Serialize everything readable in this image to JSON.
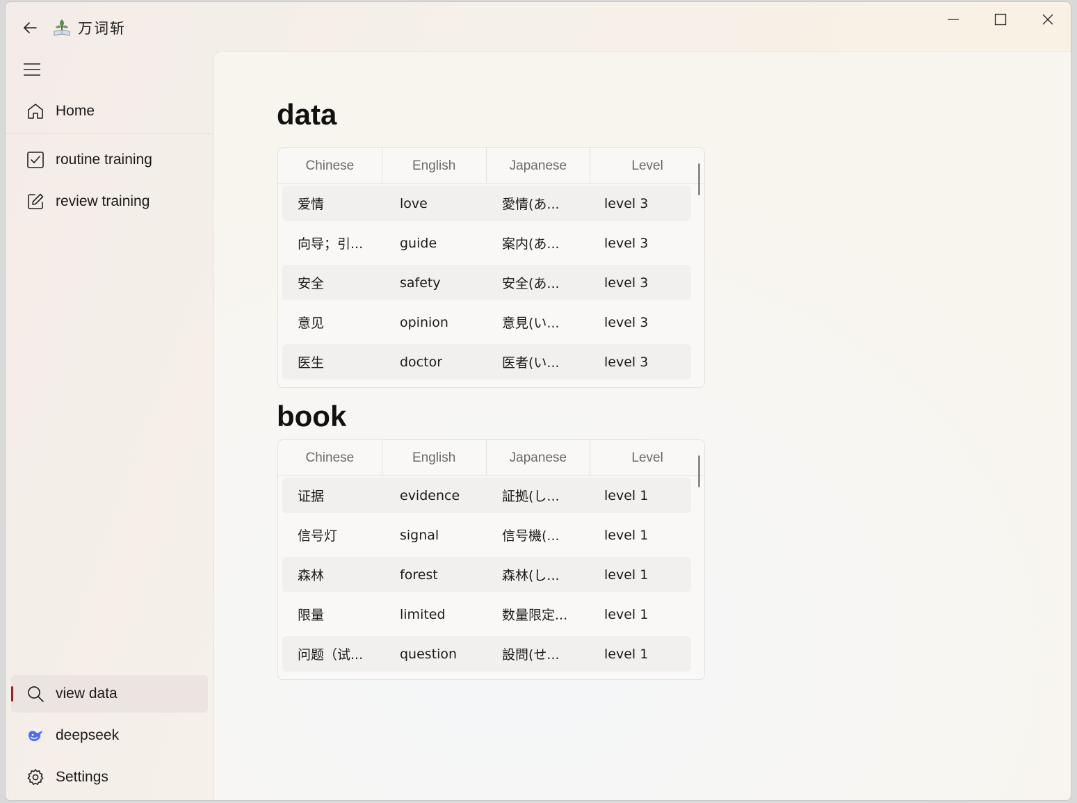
{
  "app": {
    "title": "万词斩"
  },
  "nav": {
    "home": "Home",
    "routine": "routine training",
    "review": "review training",
    "view_data": "view data",
    "deepseek": "deepseek",
    "settings": "Settings"
  },
  "tables": [
    {
      "title": "data",
      "headers": [
        "Chinese",
        "English",
        "Japanese",
        "Level"
      ],
      "rows": [
        [
          "爱情",
          "love",
          "愛情(あ...",
          "level 3"
        ],
        [
          "向导；引...",
          "guide",
          "案内(あ...",
          "level 3"
        ],
        [
          "安全",
          "safety",
          "安全(あ...",
          "level 3"
        ],
        [
          "意见",
          "opinion",
          "意見(い...",
          "level 3"
        ],
        [
          "医生",
          "doctor",
          "医者(い...",
          "level 3"
        ]
      ]
    },
    {
      "title": "book",
      "headers": [
        "Chinese",
        "English",
        "Japanese",
        "Level"
      ],
      "rows": [
        [
          "证据",
          "evidence",
          "証拠(し...",
          "level 1"
        ],
        [
          "信号灯",
          "signal",
          "信号機(...",
          "level 1"
        ],
        [
          "森林",
          "forest",
          "森林(し...",
          "level 1"
        ],
        [
          "限量",
          "limited",
          "数量限定...",
          "level 1"
        ],
        [
          "问题（试...",
          "question",
          "設問(せ...",
          "level 1"
        ]
      ]
    }
  ],
  "colors": {
    "accent": "#a31d20",
    "deepseek": "#4d6bfe"
  }
}
